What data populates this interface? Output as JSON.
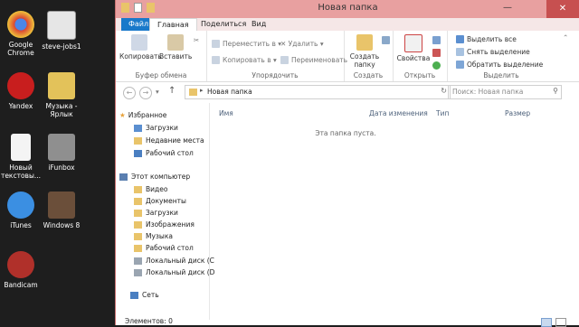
{
  "desktop": {
    "icons": [
      {
        "label": "Google Chrome",
        "color": "#d94434"
      },
      {
        "label": "steve-jobs1",
        "color": "#e6e6e6"
      },
      {
        "label": "Yandex",
        "color": "#c81e1e"
      },
      {
        "label": "Музыка - Ярлык",
        "color": "#e3c25a"
      },
      {
        "label": "Новый текстовы...",
        "color": "#f4f4f4"
      },
      {
        "label": "iFunbox",
        "color": "#8f8f8f"
      },
      {
        "label": "iTunes",
        "color": "#3b8fe2"
      },
      {
        "label": "Windows 8",
        "color": "#6b4f3a"
      },
      {
        "label": "Bandicam",
        "color": "#b0302a"
      }
    ]
  },
  "window": {
    "title": "Новая папка",
    "minimize": "—",
    "close": "✕"
  },
  "tabs": [
    "Файл",
    "Главная",
    "Поделиться",
    "Вид"
  ],
  "ribbon": {
    "clipboard": {
      "copy": "Копировать",
      "paste": "Вставить",
      "group": "Буфер обмена"
    },
    "organize": {
      "move": "Переместить в",
      "copy": "Копировать в",
      "delete": "Удалить",
      "rename": "Переименовать",
      "group": "Упорядочить"
    },
    "create": {
      "new_folder": "Создать папку",
      "group": "Создать"
    },
    "open": {
      "properties": "Свойства",
      "group": "Открыть"
    },
    "select": {
      "select_all": "Выделить все",
      "select_none": "Снять выделение",
      "invert": "Обратить выделение",
      "group": "Выделить"
    }
  },
  "address": {
    "path": "Новая папка",
    "search_placeholder": "Поиск: Новая папка"
  },
  "navpane": {
    "favorites": "Избранное",
    "fav_items": [
      "Загрузки",
      "Недавние места",
      "Рабочий стол"
    ],
    "computer": "Этот компьютер",
    "comp_items": [
      "Видео",
      "Документы",
      "Загрузки",
      "Изображения",
      "Музыка",
      "Рабочий стол",
      "Локальный диск (С",
      "Локальный диск (D"
    ],
    "network": "Сеть"
  },
  "columns": [
    "Имя",
    "Дата изменения",
    "Тип",
    "Размер"
  ],
  "empty_message": "Эта папка пуста.",
  "status": "Элементов: 0",
  "colors": {
    "title_bar": "#e8a0a0",
    "accent": "#1979ca",
    "folder": "#e9c46a"
  }
}
